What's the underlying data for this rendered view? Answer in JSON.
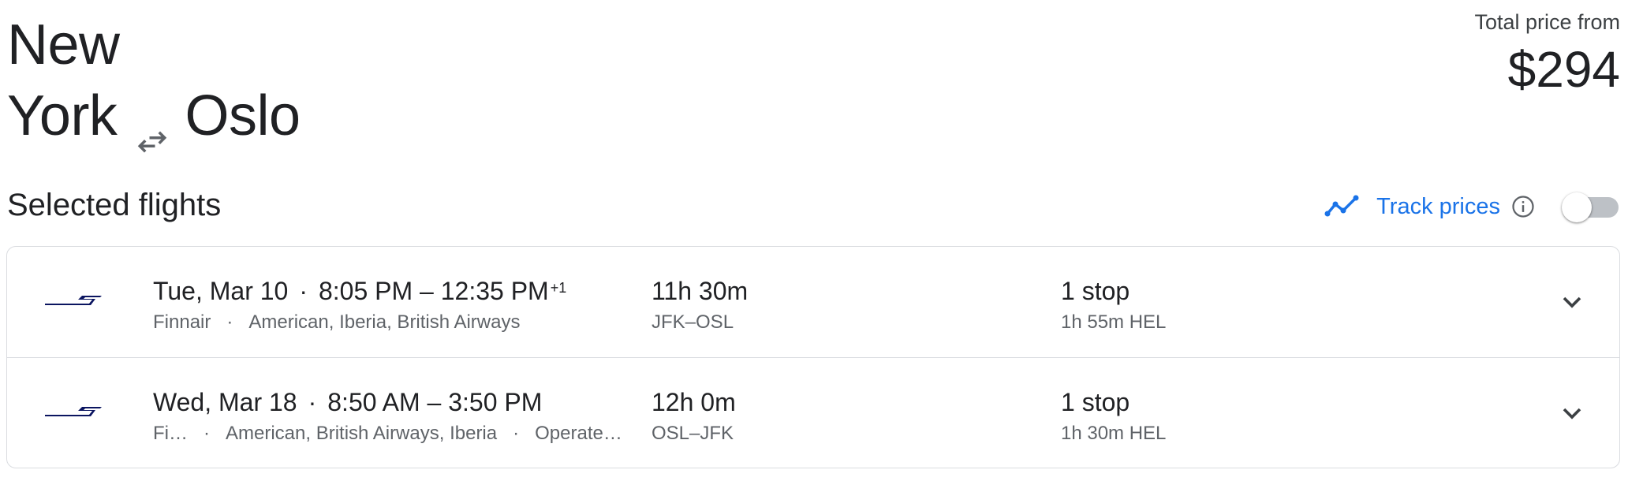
{
  "route": {
    "origin": "New York",
    "origin_line1": "New",
    "origin_line2": "York",
    "destination": "Oslo",
    "swap_icon": "swap-arrows-icon"
  },
  "price": {
    "label": "Total price from",
    "value": "$294"
  },
  "section": {
    "heading": "Selected flights"
  },
  "track": {
    "label": "Track prices",
    "icon": "trend-line-icon",
    "info_icon": "info-icon",
    "toggle_on": false
  },
  "flights": [
    {
      "date": "Tue, Mar 10",
      "depart": "8:05 PM",
      "arrive": "12:35 PM",
      "day_offset": "+1",
      "airline": "Finnair",
      "partners": "American, Iberia, British Airways",
      "operated": "",
      "duration": "11h 30m",
      "route": "JFK–OSL",
      "stops": "1 stop",
      "layover": "1h 55m HEL"
    },
    {
      "date": "Wed, Mar 18",
      "depart": "8:50 AM",
      "arrive": "3:50 PM",
      "day_offset": "",
      "airline": "Fi…",
      "partners": "American, British Airways, Iberia",
      "operated": "Operate…",
      "duration": "12h 0m",
      "route": "OSL–JFK",
      "stops": "1 stop",
      "layover": "1h 30m HEL"
    }
  ],
  "colors": {
    "accent": "#1a73e8",
    "finnair_blue": "#0b1560",
    "text": "#202124",
    "muted": "#5f6368",
    "border": "#dadce0"
  }
}
